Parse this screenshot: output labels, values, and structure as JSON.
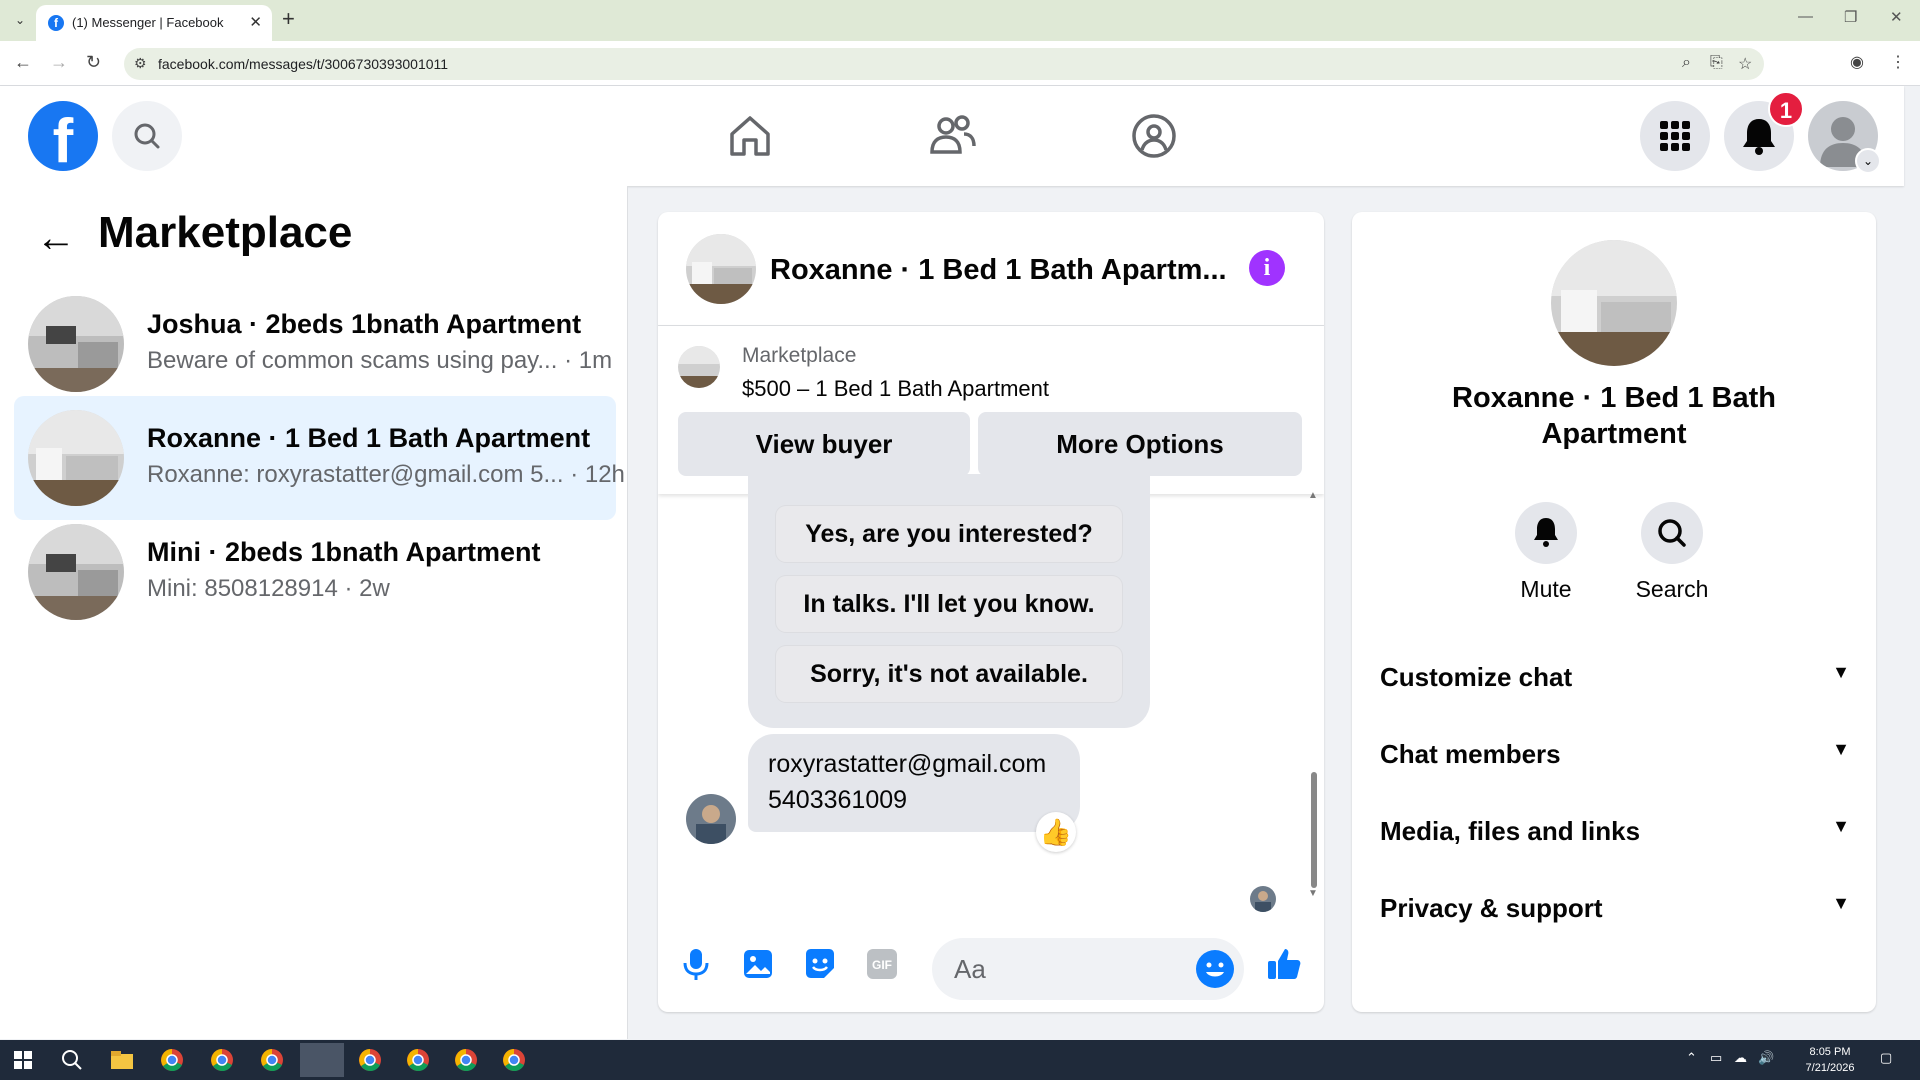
{
  "browser": {
    "tab_title": "(1) Messenger | Facebook",
    "url": "facebook.com/messages/t/3006730393001011"
  },
  "header": {
    "notification_count": "1"
  },
  "sidebar": {
    "title": "Marketplace",
    "conversations": [
      {
        "name": "Joshua · 2beds 1bnath Apartment",
        "snippet": "Beware of common scams using pay...",
        "time": "· 1m",
        "active": false
      },
      {
        "name": "Roxanne · 1 Bed 1 Bath Apartment",
        "snippet": "Roxanne: roxyrastatter@gmail.com 5...",
        "time": "· 12h",
        "active": true
      },
      {
        "name": "Mini · 2beds 1bnath Apartment",
        "snippet": "Mini: 8508128914",
        "time": "· 2w",
        "active": false
      }
    ]
  },
  "chat": {
    "title": "Roxanne · 1 Bed 1 Bath Apartm...",
    "marketplace_label": "Marketplace",
    "listing": "$500 – 1 Bed 1 Bath Apartment",
    "view_buyer": "View buyer",
    "more_options": "More Options",
    "quick_replies": [
      "Yes, are you interested?",
      "In talks. I'll let you know.",
      "Sorry, it's not available."
    ],
    "message_lines": [
      "roxyrastatter@gmail.com",
      "5403361009"
    ],
    "reaction": "👍",
    "composer_placeholder": "Aa"
  },
  "details": {
    "name": "Roxanne · 1 Bed 1 Bath Apartment",
    "mute_label": "Mute",
    "search_label": "Search",
    "sections": [
      "Customize chat",
      "Chat members",
      "Media, files and links",
      "Privacy & support"
    ]
  },
  "taskbar": {
    "time": "8:05 PM",
    "date": "7/21/2026"
  },
  "colors": {
    "fb_blue": "#1877f2",
    "messenger_blue": "#0a7cff",
    "info_purple": "#a033ff",
    "badge_red": "#e41e3f"
  }
}
